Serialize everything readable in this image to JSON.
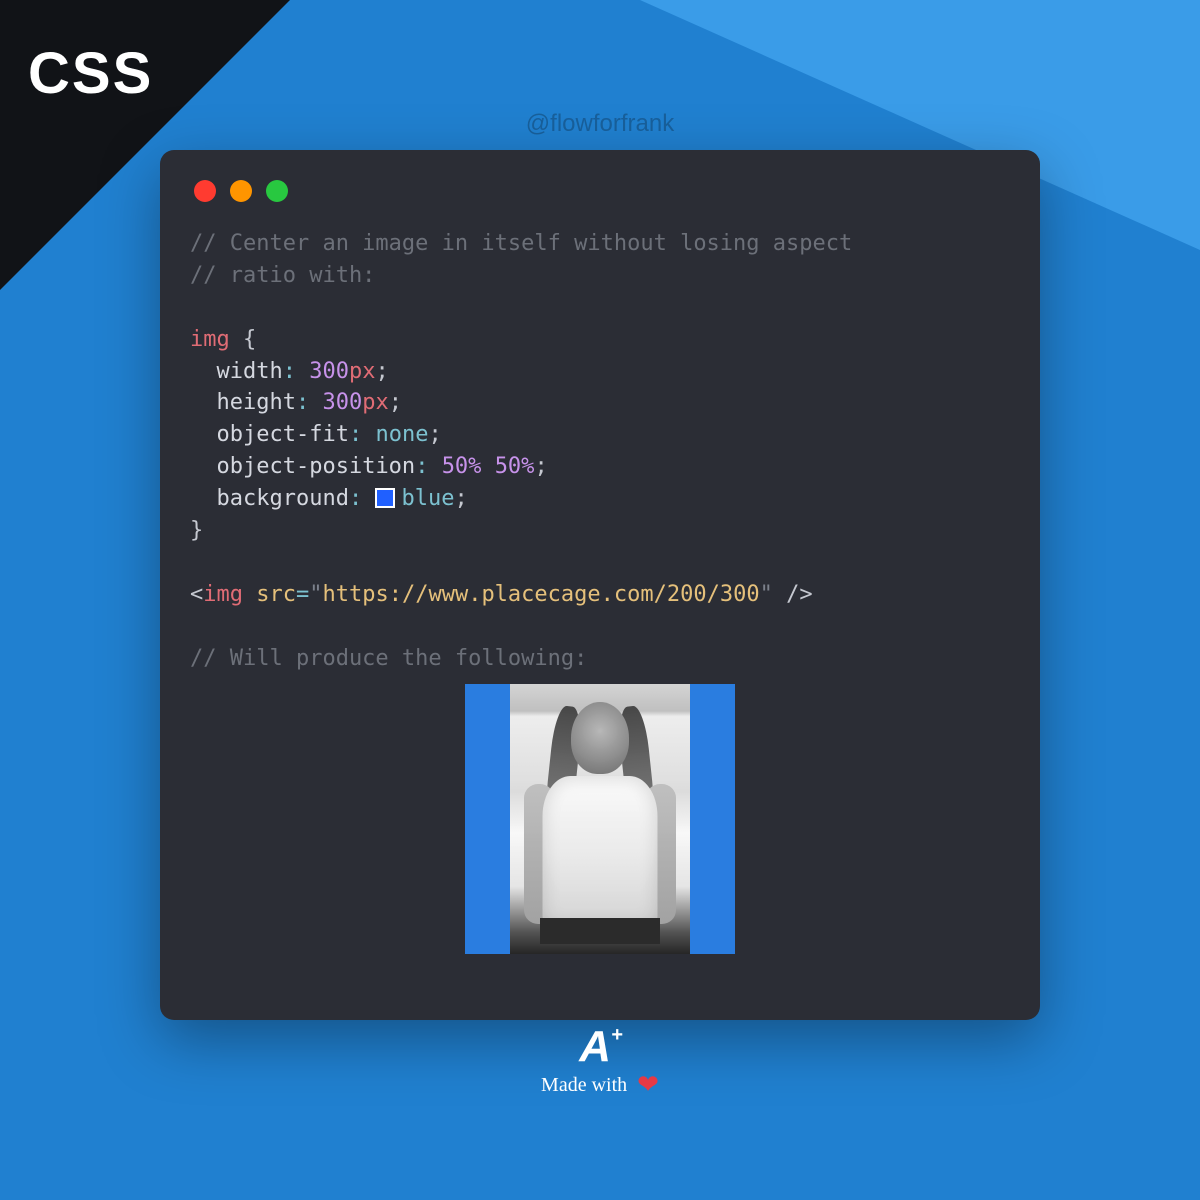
{
  "header": {
    "badge": "CSS",
    "handle": "@flowforfrank"
  },
  "code": {
    "comment1": "// Center an image in itself without losing aspect",
    "comment2": "// ratio with:",
    "selector": "img",
    "brace_open": "{",
    "props": {
      "width": {
        "name": "width",
        "num": "300",
        "unit": "px"
      },
      "height": {
        "name": "height",
        "num": "300",
        "unit": "px"
      },
      "object_fit": {
        "name": "object-fit",
        "kw": "none"
      },
      "object_position": {
        "name": "object-position",
        "v1": "50%",
        "v2": "50%"
      },
      "background": {
        "name": "background",
        "kw": "blue"
      }
    },
    "brace_close": "}",
    "html_tag": "img",
    "html_attr": "src",
    "html_url": "https://www.placecage.com/200/300",
    "comment3": "// Will produce the following:"
  },
  "footer": {
    "logo_letter": "A",
    "logo_plus": "+",
    "made_with": "Made with"
  }
}
